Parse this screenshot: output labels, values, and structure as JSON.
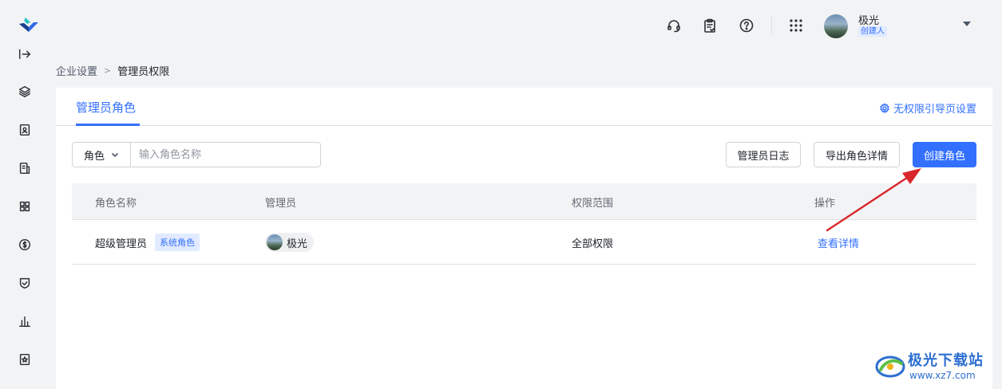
{
  "topbar": {
    "icons": [
      "headset-icon",
      "clipboard-icon",
      "help-icon",
      "apps-grid-icon"
    ],
    "user_name": "极光",
    "user_role": "创建人"
  },
  "breadcrumb": {
    "parent": "企业设置",
    "separator": ">",
    "current": "管理员权限"
  },
  "tabs": {
    "active": "管理员角色",
    "no_permission_link": "无权限引导页设置"
  },
  "filter": {
    "select_value": "角色",
    "placeholder": "输入角色名称"
  },
  "buttons": {
    "admin_log": "管理员日志",
    "export_roles": "导出角色详情",
    "create_role": "创建角色"
  },
  "table": {
    "headers": [
      "角色名称",
      "管理员",
      "权限范围",
      "操作"
    ],
    "rows": [
      {
        "role_name": "超级管理员",
        "tag": "系统角色",
        "admin": "极光",
        "scope": "全部权限",
        "action": "查看详情"
      }
    ]
  },
  "watermark": {
    "title": "极光下载站",
    "url": "www.xz7.com"
  },
  "colors": {
    "primary": "#3370ff",
    "annotation_arrow": "#d9262b"
  }
}
